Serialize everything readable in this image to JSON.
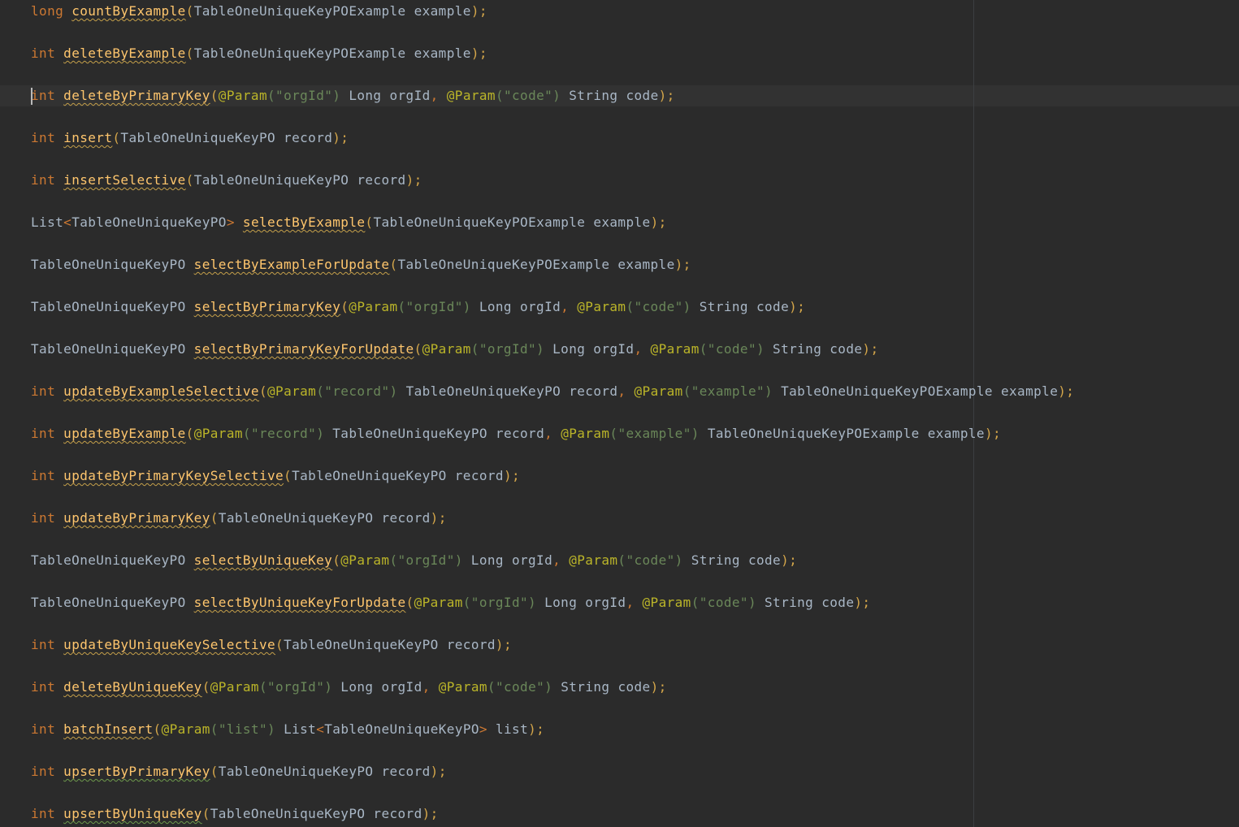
{
  "editor": {
    "language": "java",
    "colors": {
      "background": "#2b2b2b",
      "keyword": "#cc7832",
      "method": "#ffc66d",
      "annotation": "#bbb529",
      "string": "#6a8759",
      "text": "#a9b7c6"
    },
    "lines": [
      {
        "segments": [
          {
            "t": "long",
            "c": "kw"
          },
          {
            "t": " ",
            "c": "plain"
          },
          {
            "t": "countByExample",
            "c": "meth"
          },
          {
            "t": "(",
            "c": "paren"
          },
          {
            "t": "TableOneUniqueKeyPOExample example",
            "c": "plain"
          },
          {
            "t": ");",
            "c": "paren"
          }
        ]
      },
      {
        "segments": [
          {
            "t": "int",
            "c": "kw"
          },
          {
            "t": " ",
            "c": "plain"
          },
          {
            "t": "deleteByExample",
            "c": "meth"
          },
          {
            "t": "(",
            "c": "paren"
          },
          {
            "t": "TableOneUniqueKeyPOExample example",
            "c": "plain"
          },
          {
            "t": ");",
            "c": "paren"
          }
        ]
      },
      {
        "segments": [
          {
            "t": "int",
            "c": "kw"
          },
          {
            "t": " ",
            "c": "plain"
          },
          {
            "t": "deleteByPrimaryKey",
            "c": "meth"
          },
          {
            "t": "(",
            "c": "paren"
          },
          {
            "t": "@Param",
            "c": "ann"
          },
          {
            "t": "(\"orgId\")",
            "c": "str"
          },
          {
            "t": " Long orgId",
            "c": "plain"
          },
          {
            "t": ", ",
            "c": "punct"
          },
          {
            "t": "@Param",
            "c": "ann"
          },
          {
            "t": "(\"code\")",
            "c": "str"
          },
          {
            "t": " String code",
            "c": "plain"
          },
          {
            "t": ");",
            "c": "paren"
          }
        ]
      },
      {
        "segments": [
          {
            "t": "int",
            "c": "kw"
          },
          {
            "t": " ",
            "c": "plain"
          },
          {
            "t": "insert",
            "c": "meth"
          },
          {
            "t": "(",
            "c": "paren"
          },
          {
            "t": "TableOneUniqueKeyPO record",
            "c": "plain"
          },
          {
            "t": ");",
            "c": "paren"
          }
        ]
      },
      {
        "segments": [
          {
            "t": "int",
            "c": "kw"
          },
          {
            "t": " ",
            "c": "plain"
          },
          {
            "t": "insertSelective",
            "c": "meth"
          },
          {
            "t": "(",
            "c": "paren"
          },
          {
            "t": "TableOneUniqueKeyPO record",
            "c": "plain"
          },
          {
            "t": ");",
            "c": "paren"
          }
        ]
      },
      {
        "segments": [
          {
            "t": "List",
            "c": "plain"
          },
          {
            "t": "<",
            "c": "punct"
          },
          {
            "t": "TableOneUniqueKeyPO",
            "c": "plain"
          },
          {
            "t": ">",
            "c": "punct"
          },
          {
            "t": " ",
            "c": "plain"
          },
          {
            "t": "selectByExample",
            "c": "meth"
          },
          {
            "t": "(",
            "c": "paren"
          },
          {
            "t": "TableOneUniqueKeyPOExample example",
            "c": "plain"
          },
          {
            "t": ");",
            "c": "paren"
          }
        ]
      },
      {
        "segments": [
          {
            "t": "TableOneUniqueKeyPO ",
            "c": "plain"
          },
          {
            "t": "selectByExampleForUpdate",
            "c": "meth"
          },
          {
            "t": "(",
            "c": "paren"
          },
          {
            "t": "TableOneUniqueKeyPOExample example",
            "c": "plain"
          },
          {
            "t": ");",
            "c": "paren"
          }
        ]
      },
      {
        "segments": [
          {
            "t": "TableOneUniqueKeyPO ",
            "c": "plain"
          },
          {
            "t": "selectByPrimaryKey",
            "c": "meth"
          },
          {
            "t": "(",
            "c": "paren"
          },
          {
            "t": "@Param",
            "c": "ann"
          },
          {
            "t": "(\"orgId\")",
            "c": "str"
          },
          {
            "t": " Long orgId",
            "c": "plain"
          },
          {
            "t": ", ",
            "c": "punct"
          },
          {
            "t": "@Param",
            "c": "ann"
          },
          {
            "t": "(\"code\")",
            "c": "str"
          },
          {
            "t": " String code",
            "c": "plain"
          },
          {
            "t": ");",
            "c": "paren"
          }
        ]
      },
      {
        "segments": [
          {
            "t": "TableOneUniqueKeyPO ",
            "c": "plain"
          },
          {
            "t": "selectByPrimaryKeyForUpdate",
            "c": "meth"
          },
          {
            "t": "(",
            "c": "paren"
          },
          {
            "t": "@Param",
            "c": "ann"
          },
          {
            "t": "(\"orgId\")",
            "c": "str"
          },
          {
            "t": " Long orgId",
            "c": "plain"
          },
          {
            "t": ", ",
            "c": "punct"
          },
          {
            "t": "@Param",
            "c": "ann"
          },
          {
            "t": "(\"code\")",
            "c": "str"
          },
          {
            "t": " String code",
            "c": "plain"
          },
          {
            "t": ");",
            "c": "paren"
          }
        ]
      },
      {
        "segments": [
          {
            "t": "int",
            "c": "kw"
          },
          {
            "t": " ",
            "c": "plain"
          },
          {
            "t": "updateByExampleSelective",
            "c": "meth"
          },
          {
            "t": "(",
            "c": "paren"
          },
          {
            "t": "@Param",
            "c": "ann"
          },
          {
            "t": "(\"record\")",
            "c": "str"
          },
          {
            "t": " TableOneUniqueKeyPO record",
            "c": "plain"
          },
          {
            "t": ", ",
            "c": "punct"
          },
          {
            "t": "@Param",
            "c": "ann"
          },
          {
            "t": "(\"example\")",
            "c": "str"
          },
          {
            "t": " TableOneUniqueKeyPOExample example",
            "c": "plain"
          },
          {
            "t": ");",
            "c": "paren"
          }
        ]
      },
      {
        "segments": [
          {
            "t": "int",
            "c": "kw"
          },
          {
            "t": " ",
            "c": "plain"
          },
          {
            "t": "updateByExample",
            "c": "meth"
          },
          {
            "t": "(",
            "c": "paren"
          },
          {
            "t": "@Param",
            "c": "ann"
          },
          {
            "t": "(\"record\")",
            "c": "str"
          },
          {
            "t": " TableOneUniqueKeyPO record",
            "c": "plain"
          },
          {
            "t": ", ",
            "c": "punct"
          },
          {
            "t": "@Param",
            "c": "ann"
          },
          {
            "t": "(\"example\")",
            "c": "str"
          },
          {
            "t": " TableOneUniqueKeyPOExample example",
            "c": "plain"
          },
          {
            "t": ");",
            "c": "paren"
          }
        ]
      },
      {
        "segments": [
          {
            "t": "int",
            "c": "kw"
          },
          {
            "t": " ",
            "c": "plain"
          },
          {
            "t": "updateByPrimaryKeySelective",
            "c": "meth"
          },
          {
            "t": "(",
            "c": "paren"
          },
          {
            "t": "TableOneUniqueKeyPO record",
            "c": "plain"
          },
          {
            "t": ");",
            "c": "paren"
          }
        ]
      },
      {
        "segments": [
          {
            "t": "int",
            "c": "kw"
          },
          {
            "t": " ",
            "c": "plain"
          },
          {
            "t": "updateByPrimaryKey",
            "c": "meth"
          },
          {
            "t": "(",
            "c": "paren"
          },
          {
            "t": "TableOneUniqueKeyPO record",
            "c": "plain"
          },
          {
            "t": ");",
            "c": "paren"
          }
        ]
      },
      {
        "segments": [
          {
            "t": "TableOneUniqueKeyPO ",
            "c": "plain"
          },
          {
            "t": "selectByUniqueKey",
            "c": "meth"
          },
          {
            "t": "(",
            "c": "paren"
          },
          {
            "t": "@Param",
            "c": "ann"
          },
          {
            "t": "(\"orgId\")",
            "c": "str"
          },
          {
            "t": " Long orgId",
            "c": "plain"
          },
          {
            "t": ", ",
            "c": "punct"
          },
          {
            "t": "@Param",
            "c": "ann"
          },
          {
            "t": "(\"code\")",
            "c": "str"
          },
          {
            "t": " String code",
            "c": "plain"
          },
          {
            "t": ");",
            "c": "paren"
          }
        ]
      },
      {
        "segments": [
          {
            "t": "TableOneUniqueKeyPO ",
            "c": "plain"
          },
          {
            "t": "selectByUniqueKeyForUpdate",
            "c": "meth"
          },
          {
            "t": "(",
            "c": "paren"
          },
          {
            "t": "@Param",
            "c": "ann"
          },
          {
            "t": "(\"orgId\")",
            "c": "str"
          },
          {
            "t": " Long orgId",
            "c": "plain"
          },
          {
            "t": ", ",
            "c": "punct"
          },
          {
            "t": "@Param",
            "c": "ann"
          },
          {
            "t": "(\"code\")",
            "c": "str"
          },
          {
            "t": " String code",
            "c": "plain"
          },
          {
            "t": ");",
            "c": "paren"
          }
        ]
      },
      {
        "segments": [
          {
            "t": "int",
            "c": "kw"
          },
          {
            "t": " ",
            "c": "plain"
          },
          {
            "t": "updateByUniqueKeySelective",
            "c": "meth"
          },
          {
            "t": "(",
            "c": "paren"
          },
          {
            "t": "TableOneUniqueKeyPO record",
            "c": "plain"
          },
          {
            "t": ");",
            "c": "paren"
          }
        ]
      },
      {
        "segments": [
          {
            "t": "int",
            "c": "kw"
          },
          {
            "t": " ",
            "c": "plain"
          },
          {
            "t": "deleteByUniqueKey",
            "c": "meth"
          },
          {
            "t": "(",
            "c": "paren"
          },
          {
            "t": "@Param",
            "c": "ann"
          },
          {
            "t": "(\"orgId\")",
            "c": "str"
          },
          {
            "t": " Long orgId",
            "c": "plain"
          },
          {
            "t": ", ",
            "c": "punct"
          },
          {
            "t": "@Param",
            "c": "ann"
          },
          {
            "t": "(\"code\")",
            "c": "str"
          },
          {
            "t": " String code",
            "c": "plain"
          },
          {
            "t": ");",
            "c": "paren"
          }
        ]
      },
      {
        "segments": [
          {
            "t": "int",
            "c": "kw"
          },
          {
            "t": " ",
            "c": "plain"
          },
          {
            "t": "batchInsert",
            "c": "meth"
          },
          {
            "t": "(",
            "c": "paren"
          },
          {
            "t": "@Param",
            "c": "ann"
          },
          {
            "t": "(\"list\")",
            "c": "str"
          },
          {
            "t": " List",
            "c": "plain"
          },
          {
            "t": "<",
            "c": "punct"
          },
          {
            "t": "TableOneUniqueKeyPO",
            "c": "plain"
          },
          {
            "t": ">",
            "c": "punct"
          },
          {
            "t": " list",
            "c": "plain"
          },
          {
            "t": ");",
            "c": "paren"
          }
        ]
      },
      {
        "segments": [
          {
            "t": "int",
            "c": "kw"
          },
          {
            "t": " ",
            "c": "plain"
          },
          {
            "t": "upsertByPrimaryKey",
            "c": "meth green"
          },
          {
            "t": "(",
            "c": "paren"
          },
          {
            "t": "TableOneUniqueKeyPO record",
            "c": "plain"
          },
          {
            "t": ");",
            "c": "paren"
          }
        ]
      },
      {
        "segments": [
          {
            "t": "int",
            "c": "kw"
          },
          {
            "t": " ",
            "c": "plain"
          },
          {
            "t": "upsertByUniqueKey",
            "c": "meth green"
          },
          {
            "t": "(",
            "c": "paren"
          },
          {
            "t": "TableOneUniqueKeyPO record",
            "c": "plain"
          },
          {
            "t": ");",
            "c": "paren"
          }
        ]
      }
    ]
  }
}
